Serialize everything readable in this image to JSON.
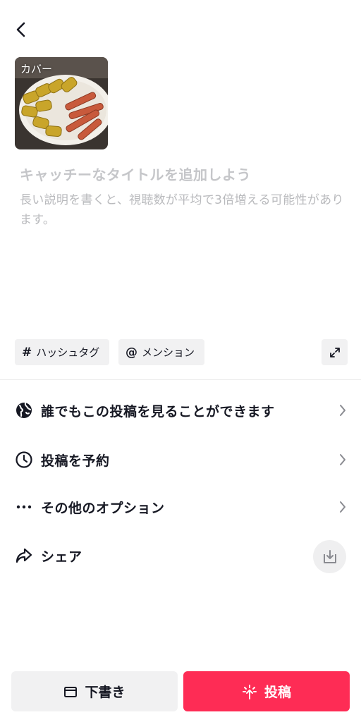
{
  "header": {
    "back_icon": "chevron-left-icon"
  },
  "cover": {
    "label": "カバー"
  },
  "caption": {
    "title_placeholder": "キャッチーなタイトルを追加しよう",
    "description_placeholder": "長い説明を書くと、視聴数が平均で3倍増える可能性があります。"
  },
  "chips": {
    "hashtag": {
      "symbol": "#",
      "label": "ハッシュタグ"
    },
    "mention": {
      "symbol": "@",
      "label": "メンション"
    }
  },
  "settings": {
    "visibility": {
      "label": "誰でもこの投稿を見ることができます",
      "icon": "globe-icon"
    },
    "schedule": {
      "label": "投稿を予約",
      "icon": "clock-icon"
    },
    "options": {
      "label": "その他のオプション",
      "icon": "more-dots-icon"
    },
    "share": {
      "label": "シェア",
      "icon": "share-icon"
    }
  },
  "actions": {
    "draft_label": "下書き",
    "post_label": "投稿"
  },
  "colors": {
    "accent": "#fe2c55",
    "chip_bg": "#f1f1f2",
    "placeholder": "#c5c6c9"
  }
}
